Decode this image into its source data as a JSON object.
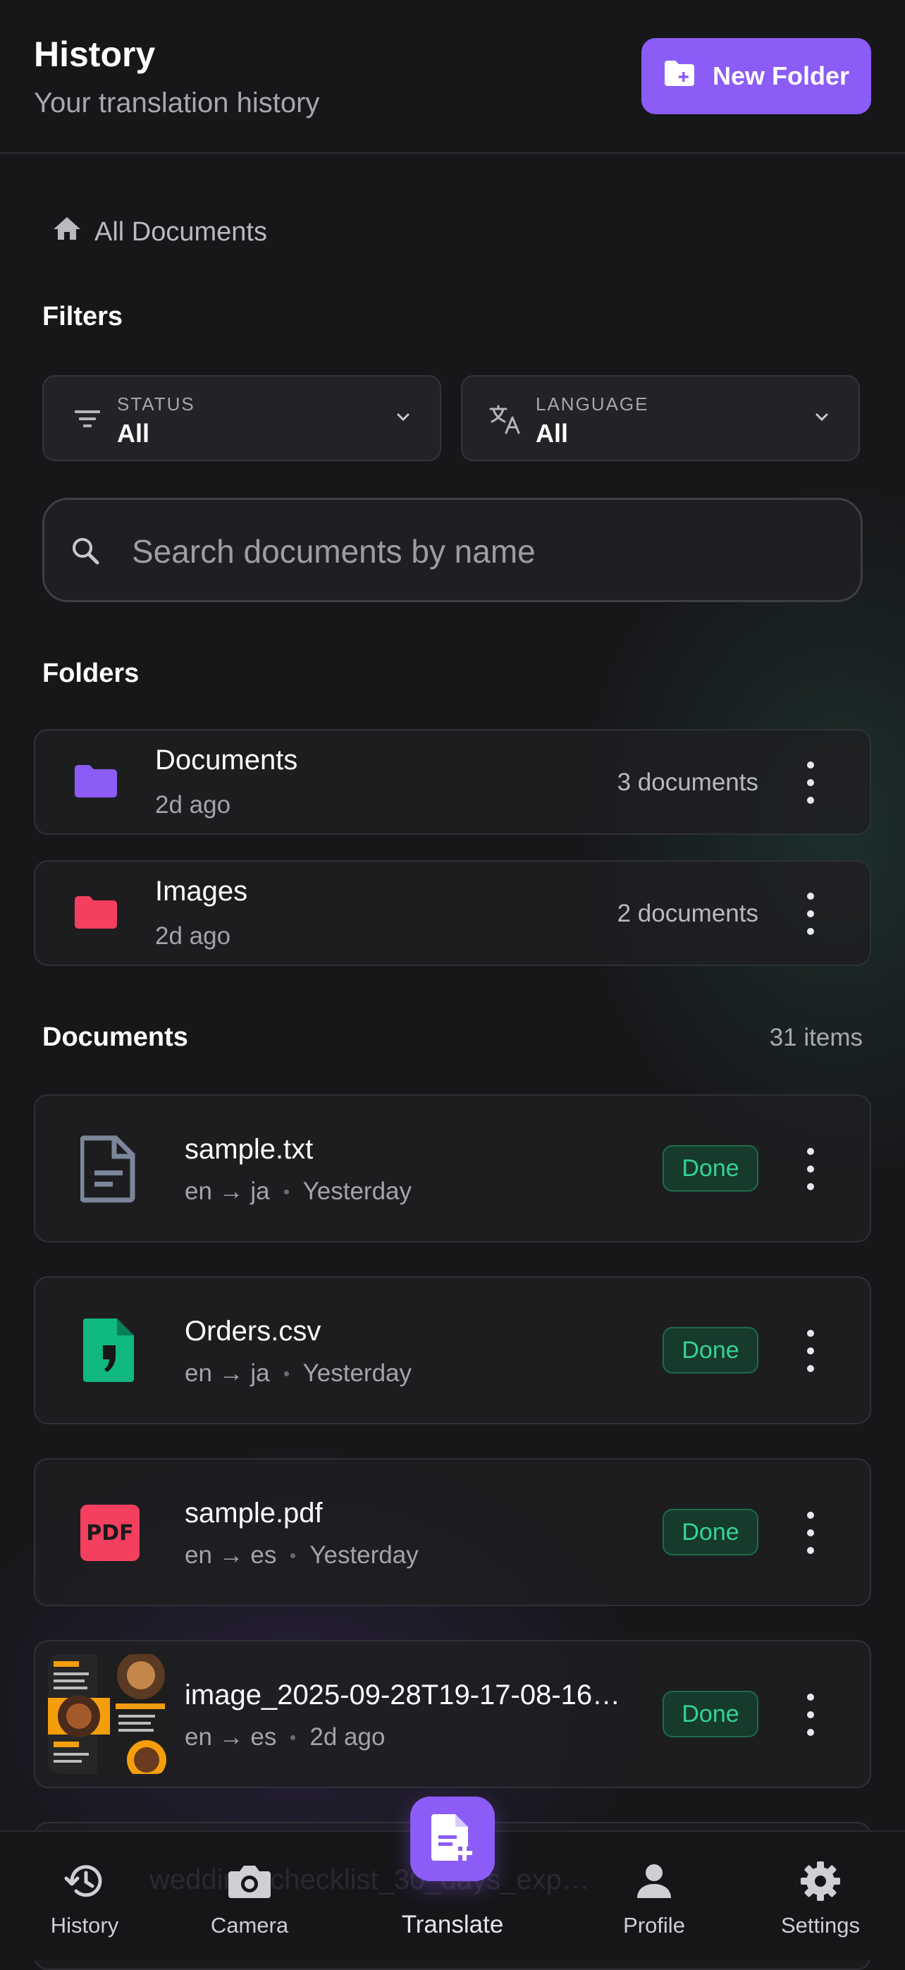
{
  "header": {
    "title": "History",
    "subtitle": "Your translation history",
    "new_folder_label": "New Folder"
  },
  "breadcrumb": {
    "label": "All Documents"
  },
  "filters": {
    "title": "Filters",
    "status": {
      "label": "STATUS",
      "value": "All"
    },
    "language": {
      "label": "LANGUAGE",
      "value": "All"
    }
  },
  "search": {
    "placeholder": "Search documents by name",
    "value": ""
  },
  "folders": {
    "title": "Folders",
    "items": [
      {
        "name": "Documents",
        "date": "2d ago",
        "count": "3 documents",
        "color": "#8b5cf6"
      },
      {
        "name": "Images",
        "date": "2d ago",
        "count": "2 documents",
        "color": "#f43f5e"
      }
    ]
  },
  "documents": {
    "title": "Documents",
    "count": "31 items",
    "items": [
      {
        "name": "sample.txt",
        "lang": "en → ja",
        "time": "Yesterday",
        "status": "Done",
        "icon": "text-file-icon"
      },
      {
        "name": "Orders.csv",
        "lang": "en → ja",
        "time": "Yesterday",
        "status": "Done",
        "icon": "csv-file-icon"
      },
      {
        "name": "sample.pdf",
        "lang": "en → es",
        "time": "Yesterday",
        "status": "Done",
        "icon": "pdf-file-icon",
        "icon_text": "PDF"
      },
      {
        "name": "image_2025-09-28T19-17-08-16…",
        "lang": "en → es",
        "time": "2d ago",
        "status": "Done",
        "icon": "image-thumbnail"
      }
    ],
    "partial_item_name": "wedding_checklist_30_days_exp…"
  },
  "tabbar": {
    "history": "History",
    "camera": "Camera",
    "translate": "Translate",
    "profile": "Profile",
    "settings": "Settings"
  },
  "colors": {
    "accent": "#8b5cf6",
    "background": "#17171a",
    "done_green": "#34d399",
    "csv_green": "#10b981",
    "pdf_red": "#f43f5e"
  }
}
